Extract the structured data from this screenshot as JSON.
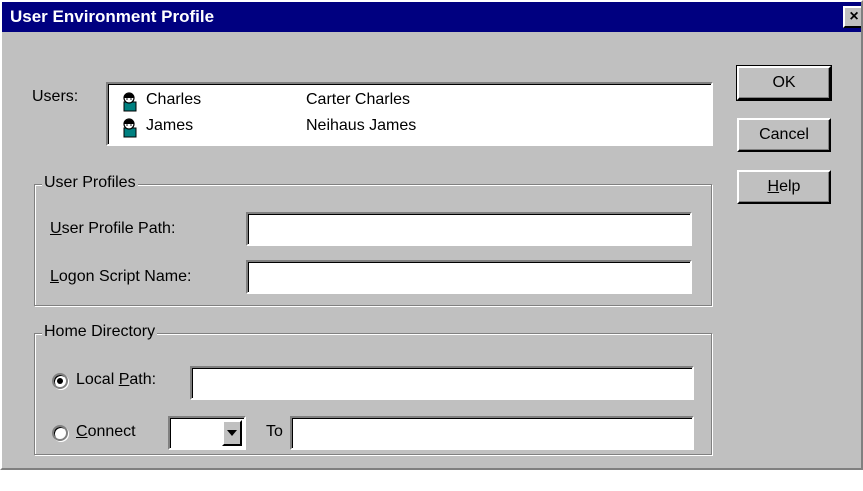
{
  "dialog": {
    "title": "User Environment Profile",
    "close_glyph": "×"
  },
  "users": {
    "label": "Users:",
    "items": [
      {
        "username": "Charles",
        "full_name": "Carter Charles",
        "icon": "user-icon"
      },
      {
        "username": "James",
        "full_name": "Neihaus James",
        "icon": "user-icon"
      }
    ]
  },
  "buttons": {
    "ok": "OK",
    "cancel": "Cancel",
    "help": {
      "mnemonic": "H",
      "rest": "elp"
    }
  },
  "user_profiles": {
    "group_title": "User Profiles",
    "profile_path_label": {
      "mnemonic": "U",
      "rest": "ser Profile Path:"
    },
    "profile_path_value": "",
    "logon_script_label": {
      "mnemonic": "L",
      "rest": "ogon Script Name:"
    },
    "logon_script_value": ""
  },
  "home_directory": {
    "group_title": "Home Directory",
    "local_path_label": {
      "pre": "Local ",
      "mnemonic": "P",
      "rest": "ath:"
    },
    "local_path_selected": true,
    "local_path_value": "",
    "connect_label": {
      "mnemonic": "C",
      "rest": "onnect"
    },
    "connect_selected": false,
    "drive_value": "",
    "to_label": "To",
    "connect_to_value": ""
  }
}
